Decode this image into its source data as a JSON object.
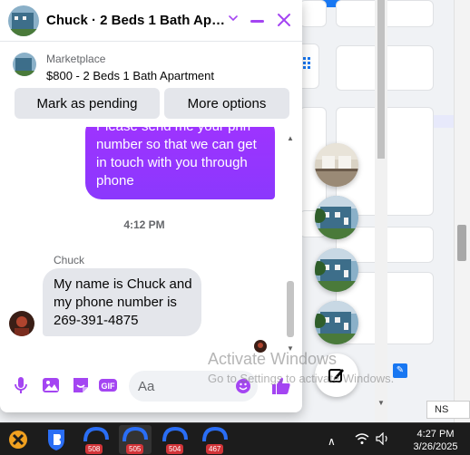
{
  "chat": {
    "title": "Chuck · 2 Beds 1 Bath Apar…",
    "marketplace_label": "Marketplace",
    "listing": "$800 - 2 Beds 1 Bath Apartment",
    "mark_pending_label": "Mark as pending",
    "more_options_label": "More options",
    "outgoing_message": "Please send me your phn number so that we can get in touch with you through phone",
    "timestamp": "4:12 PM",
    "sender_name": "Chuck",
    "incoming_message": "My name is Chuck and my phone number is 269-391-4875",
    "composer_placeholder": "Aa",
    "accent_color": "#a445f2"
  },
  "overlay": {
    "activate_title": "Activate Windows",
    "activate_sub": "Go to Settings to activate Windows."
  },
  "background": {
    "ns_tab": "NS"
  },
  "taskbar": {
    "badges": [
      "508",
      "505",
      "504",
      "467"
    ],
    "time": "4:27 PM",
    "date": "3/26/2025"
  }
}
